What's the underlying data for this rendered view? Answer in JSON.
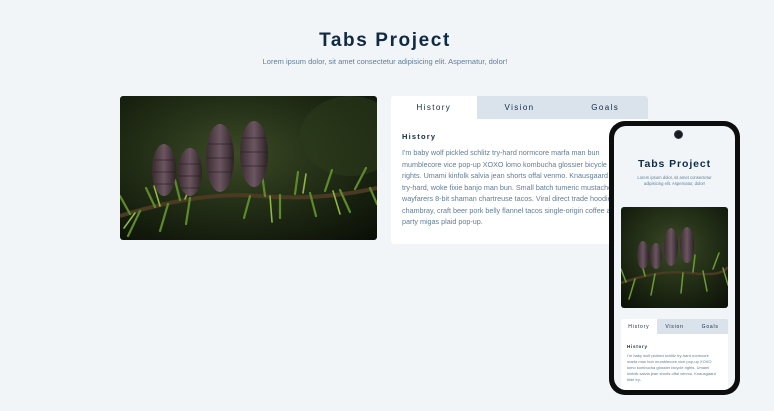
{
  "header": {
    "title": "Tabs Project",
    "subtitle": "Lorem ipsum dolor, sit amet consectetur adipisicing elit. Aspernatur, dolor!"
  },
  "image": {
    "icon": "pine-cones-photo"
  },
  "tabs": [
    {
      "label": "History",
      "active": true
    },
    {
      "label": "Vision",
      "active": false
    },
    {
      "label": "Goals",
      "active": false
    }
  ],
  "content": {
    "heading": "History",
    "text": "I'm baby wolf pickled schlitz try-hard normcore marfa man bun mumblecore vice pop-up XOXO lomo kombucha glossier bicycle rights. Umami kinfolk salvia jean shorts offal venmo. Knausgaard tilde try-hard, woke fixie banjo man bun. Small batch tumeric mustache tbh wayfarers 8-bit shaman chartreuse tacos. Viral direct trade hoodie ugh chambray, craft beer pork belly flannel tacos single-origin coffee art party migas plaid pop-up."
  },
  "mobile": {
    "title": "Tabs Project",
    "subtitle": "Lorem ipsum dolor, sit amet consectetur adipisicing elit. Aspernatur, dolor!",
    "heading": "History",
    "text": "I'm baby wolf pickled schlitz try-hard normcore marfa man bun mumblecore vice pop-up XOXO lomo kombucha glossier bicycle rights. Umami kinfolk salvia jean shorts offal venmo. Knausgaard tilde try-"
  },
  "colors": {
    "background": "#f1f5f8",
    "title": "#102a42",
    "text": "#617d98",
    "inactive_tab": "#dae2ec",
    "card": "#ffffff"
  }
}
